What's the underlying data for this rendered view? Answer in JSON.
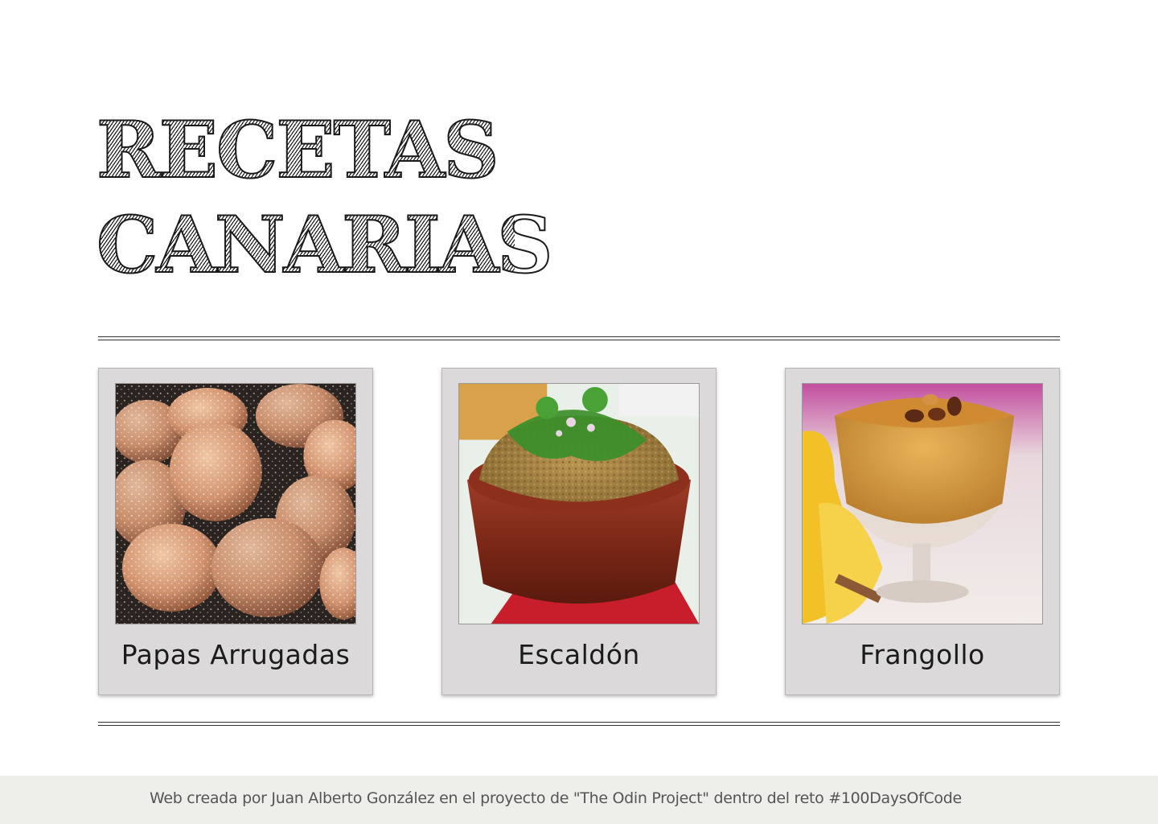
{
  "header": {
    "title_line_1": "RECETAS",
    "title_line_2": "CANARIAS"
  },
  "recipes": [
    {
      "name": "Papas Arrugadas",
      "photo_icon": "papas-arrugadas-photo"
    },
    {
      "name": "Escaldón",
      "photo_icon": "escaldon-photo"
    },
    {
      "name": "Frangollo",
      "photo_icon": "frangollo-photo"
    }
  ],
  "footer": {
    "text": "Web creada por Juan Alberto González en el proyecto de \"The Odin Project\" dentro del reto #100DaysOfCode"
  },
  "colors": {
    "card_background": "#dbd9da",
    "footer_background": "#eeeeea",
    "rule": "#333333"
  }
}
